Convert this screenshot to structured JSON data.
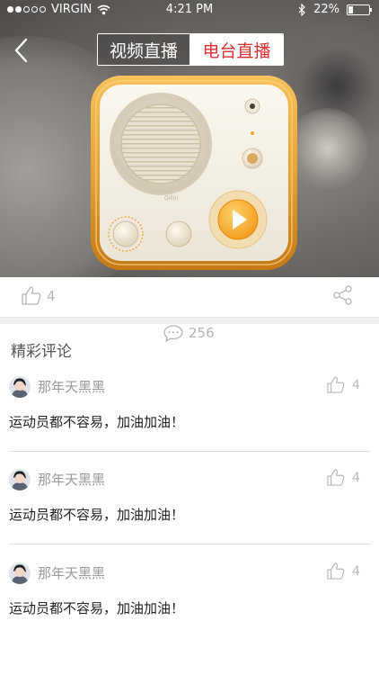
{
  "status_bar": {
    "carrier": "VIRGIN",
    "time": "4:21 PM",
    "battery_text": "22%",
    "battery_level": 0.22
  },
  "header": {
    "tab_video": "视频直播",
    "tab_radio": "电台直播",
    "active_tab": "radio"
  },
  "actions": {
    "like_count": "4",
    "comment_count": "256"
  },
  "comments_section": {
    "title": "精彩评论",
    "items": [
      {
        "user": "那年天黑黑",
        "text": "运动员都不容易，加油加油！",
        "likes": "4"
      },
      {
        "user": "那年天黑黑",
        "text": "运动员都不容易，加油加油！",
        "likes": "4"
      },
      {
        "user": "那年天黑黑",
        "text": "运动员都不容易，加油加油！",
        "likes": "4"
      }
    ]
  },
  "colors": {
    "accent_red": "#d8302f",
    "icon_gray": "#b5b5b5"
  }
}
